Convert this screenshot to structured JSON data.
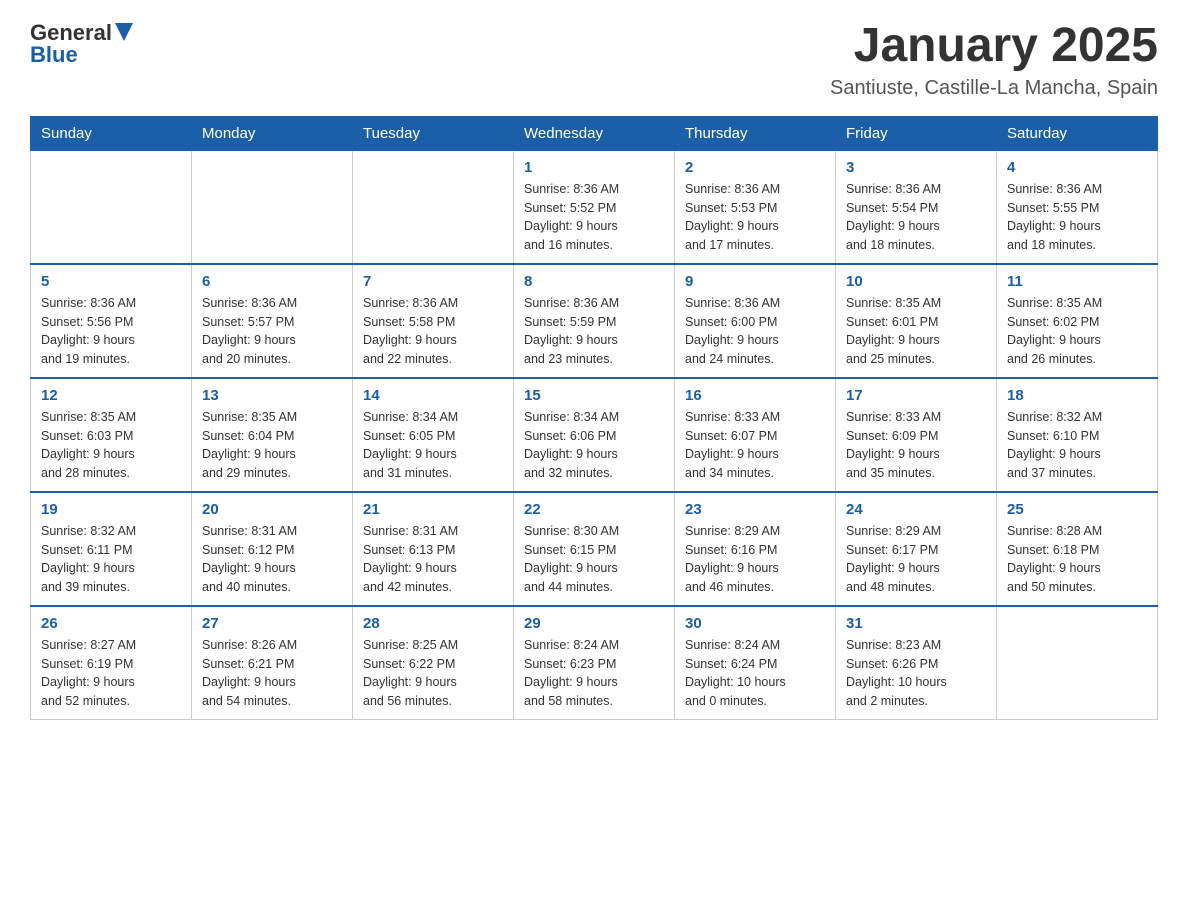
{
  "header": {
    "logo": {
      "general": "General",
      "blue": "Blue"
    },
    "title": "January 2025",
    "location": "Santiuste, Castille-La Mancha, Spain"
  },
  "weekdays": [
    "Sunday",
    "Monday",
    "Tuesday",
    "Wednesday",
    "Thursday",
    "Friday",
    "Saturday"
  ],
  "weeks": [
    [
      {
        "day": "",
        "info": ""
      },
      {
        "day": "",
        "info": ""
      },
      {
        "day": "",
        "info": ""
      },
      {
        "day": "1",
        "info": "Sunrise: 8:36 AM\nSunset: 5:52 PM\nDaylight: 9 hours\nand 16 minutes."
      },
      {
        "day": "2",
        "info": "Sunrise: 8:36 AM\nSunset: 5:53 PM\nDaylight: 9 hours\nand 17 minutes."
      },
      {
        "day": "3",
        "info": "Sunrise: 8:36 AM\nSunset: 5:54 PM\nDaylight: 9 hours\nand 18 minutes."
      },
      {
        "day": "4",
        "info": "Sunrise: 8:36 AM\nSunset: 5:55 PM\nDaylight: 9 hours\nand 18 minutes."
      }
    ],
    [
      {
        "day": "5",
        "info": "Sunrise: 8:36 AM\nSunset: 5:56 PM\nDaylight: 9 hours\nand 19 minutes."
      },
      {
        "day": "6",
        "info": "Sunrise: 8:36 AM\nSunset: 5:57 PM\nDaylight: 9 hours\nand 20 minutes."
      },
      {
        "day": "7",
        "info": "Sunrise: 8:36 AM\nSunset: 5:58 PM\nDaylight: 9 hours\nand 22 minutes."
      },
      {
        "day": "8",
        "info": "Sunrise: 8:36 AM\nSunset: 5:59 PM\nDaylight: 9 hours\nand 23 minutes."
      },
      {
        "day": "9",
        "info": "Sunrise: 8:36 AM\nSunset: 6:00 PM\nDaylight: 9 hours\nand 24 minutes."
      },
      {
        "day": "10",
        "info": "Sunrise: 8:35 AM\nSunset: 6:01 PM\nDaylight: 9 hours\nand 25 minutes."
      },
      {
        "day": "11",
        "info": "Sunrise: 8:35 AM\nSunset: 6:02 PM\nDaylight: 9 hours\nand 26 minutes."
      }
    ],
    [
      {
        "day": "12",
        "info": "Sunrise: 8:35 AM\nSunset: 6:03 PM\nDaylight: 9 hours\nand 28 minutes."
      },
      {
        "day": "13",
        "info": "Sunrise: 8:35 AM\nSunset: 6:04 PM\nDaylight: 9 hours\nand 29 minutes."
      },
      {
        "day": "14",
        "info": "Sunrise: 8:34 AM\nSunset: 6:05 PM\nDaylight: 9 hours\nand 31 minutes."
      },
      {
        "day": "15",
        "info": "Sunrise: 8:34 AM\nSunset: 6:06 PM\nDaylight: 9 hours\nand 32 minutes."
      },
      {
        "day": "16",
        "info": "Sunrise: 8:33 AM\nSunset: 6:07 PM\nDaylight: 9 hours\nand 34 minutes."
      },
      {
        "day": "17",
        "info": "Sunrise: 8:33 AM\nSunset: 6:09 PM\nDaylight: 9 hours\nand 35 minutes."
      },
      {
        "day": "18",
        "info": "Sunrise: 8:32 AM\nSunset: 6:10 PM\nDaylight: 9 hours\nand 37 minutes."
      }
    ],
    [
      {
        "day": "19",
        "info": "Sunrise: 8:32 AM\nSunset: 6:11 PM\nDaylight: 9 hours\nand 39 minutes."
      },
      {
        "day": "20",
        "info": "Sunrise: 8:31 AM\nSunset: 6:12 PM\nDaylight: 9 hours\nand 40 minutes."
      },
      {
        "day": "21",
        "info": "Sunrise: 8:31 AM\nSunset: 6:13 PM\nDaylight: 9 hours\nand 42 minutes."
      },
      {
        "day": "22",
        "info": "Sunrise: 8:30 AM\nSunset: 6:15 PM\nDaylight: 9 hours\nand 44 minutes."
      },
      {
        "day": "23",
        "info": "Sunrise: 8:29 AM\nSunset: 6:16 PM\nDaylight: 9 hours\nand 46 minutes."
      },
      {
        "day": "24",
        "info": "Sunrise: 8:29 AM\nSunset: 6:17 PM\nDaylight: 9 hours\nand 48 minutes."
      },
      {
        "day": "25",
        "info": "Sunrise: 8:28 AM\nSunset: 6:18 PM\nDaylight: 9 hours\nand 50 minutes."
      }
    ],
    [
      {
        "day": "26",
        "info": "Sunrise: 8:27 AM\nSunset: 6:19 PM\nDaylight: 9 hours\nand 52 minutes."
      },
      {
        "day": "27",
        "info": "Sunrise: 8:26 AM\nSunset: 6:21 PM\nDaylight: 9 hours\nand 54 minutes."
      },
      {
        "day": "28",
        "info": "Sunrise: 8:25 AM\nSunset: 6:22 PM\nDaylight: 9 hours\nand 56 minutes."
      },
      {
        "day": "29",
        "info": "Sunrise: 8:24 AM\nSunset: 6:23 PM\nDaylight: 9 hours\nand 58 minutes."
      },
      {
        "day": "30",
        "info": "Sunrise: 8:24 AM\nSunset: 6:24 PM\nDaylight: 10 hours\nand 0 minutes."
      },
      {
        "day": "31",
        "info": "Sunrise: 8:23 AM\nSunset: 6:26 PM\nDaylight: 10 hours\nand 2 minutes."
      },
      {
        "day": "",
        "info": ""
      }
    ]
  ]
}
